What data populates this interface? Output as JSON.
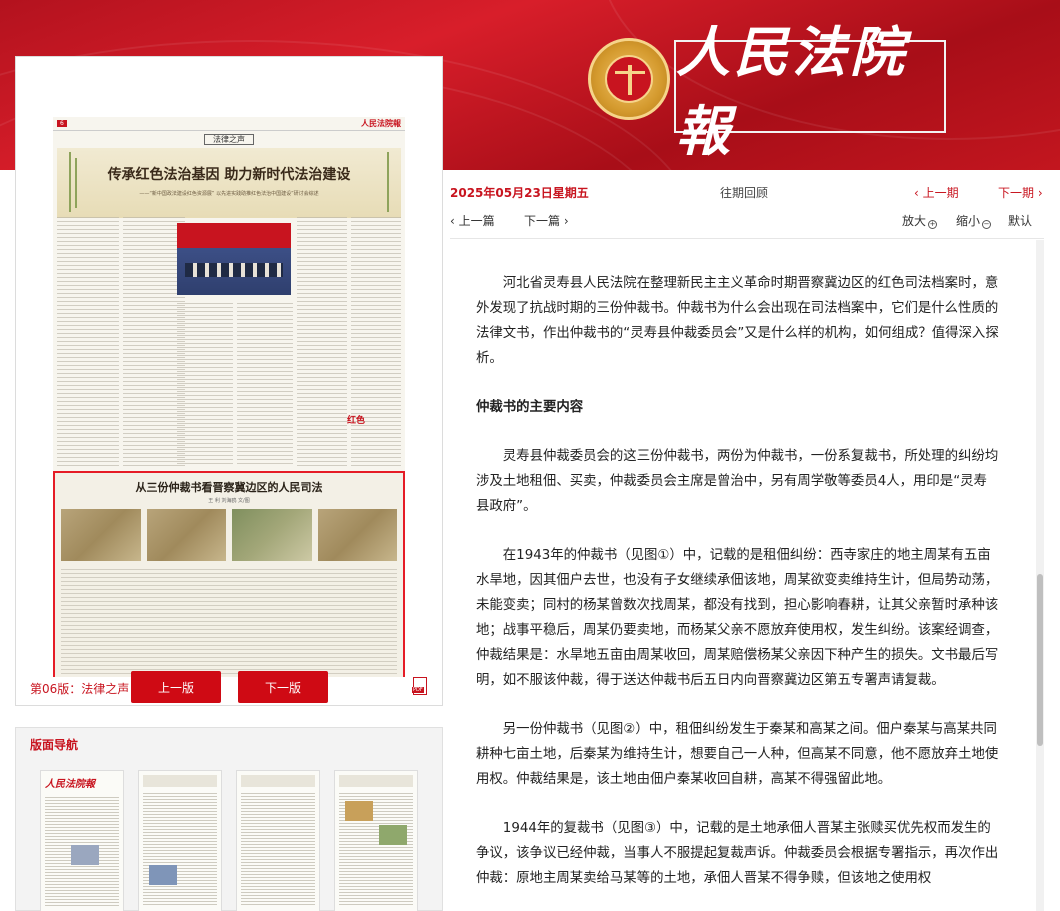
{
  "header": {
    "logo_text": "人民法院報"
  },
  "newspaper": {
    "page_no": "6",
    "brand": "人民法院報",
    "section": "法律之声",
    "headline": "传承红色法治基因  助力新时代法治建设",
    "subhead": "——“新中国政法建设红色资源展”  以先进实践助推红色法治中国建设”研讨会综述",
    "box_title": "从三份仲裁书看晋察冀边区的人民司法",
    "box_author": "王 利  刘海鸥 文/图",
    "stamp": "红色"
  },
  "edition": {
    "label": "第06版：法律之声",
    "prev_label": "上一版",
    "next_label": "下一版"
  },
  "layout_nav": {
    "title": "版面导航",
    "thumb_brand": "人民法院報"
  },
  "issue": {
    "date": "2025年05月23日星期五",
    "past": "往期回顾",
    "prev_issue": "‹ 上一期",
    "next_issue": "下一期 ›"
  },
  "tools": {
    "prev_article": "‹ 上一篇",
    "next_article": "下一篇 ›",
    "zoom_in": "放大",
    "zoom_out": "缩小",
    "default": "默认"
  },
  "article": {
    "p1": "河北省灵寿县人民法院在整理新民主主义革命时期晋察冀边区的红色司法档案时，意外发现了抗战时期的三份仲裁书。仲裁书为什么会出现在司法档案中，它们是什么性质的法律文书，作出仲裁书的“灵寿县仲裁委员会”又是什么样的机构，如何组成？值得深入探析。",
    "h1": "仲裁书的主要内容",
    "p2": "灵寿县仲裁委员会的这三份仲裁书，两份为仲裁书，一份系复裁书，所处理的纠纷均涉及土地租佃、买卖，仲裁委员会主席是曾治中，另有周学敬等委员4人，用印是“灵寿县政府”。",
    "p3": "在1943年的仲裁书（见图①）中，记载的是租佃纠纷：西寺家庄的地主周某有五亩水旱地，因其佃户去世，也没有子女继续承佃该地，周某欲变卖维持生计，但局势动荡，未能变卖；同村的杨某曾数次找周某，都没有找到，担心影响春耕，让其父亲暂时承种该地；战事平稳后，周某仍要卖地，而杨某父亲不愿放弃使用权，发生纠纷。该案经调查，仲裁结果是：水旱地五亩由周某收回，周某赔偿杨某父亲因下种产生的损失。文书最后写明，如不服该仲裁，得于送达仲裁书后五日内向晋察冀边区第五专署声请复裁。",
    "p4": "另一份仲裁书（见图②）中，租佃纠纷发生于秦某和高某之间。佃户秦某与高某共同耕种七亩土地，后秦某为维持生计，想要自己一人种，但高某不同意，他不愿放弃土地使用权。仲裁结果是，该土地由佃户秦某收回自耕，高某不得强留此地。",
    "p5": "1944年的复裁书（见图③）中，记载的是土地承佃人晋某主张赎买优先权而发生的争议，该争议已经仲裁，当事人不服提起复裁声诉。仲裁委员会根据专署指示，再次作出仲裁：原地主周某卖给马某等的土地，承佃人晋某不得争赎，但该地之使用权"
  }
}
